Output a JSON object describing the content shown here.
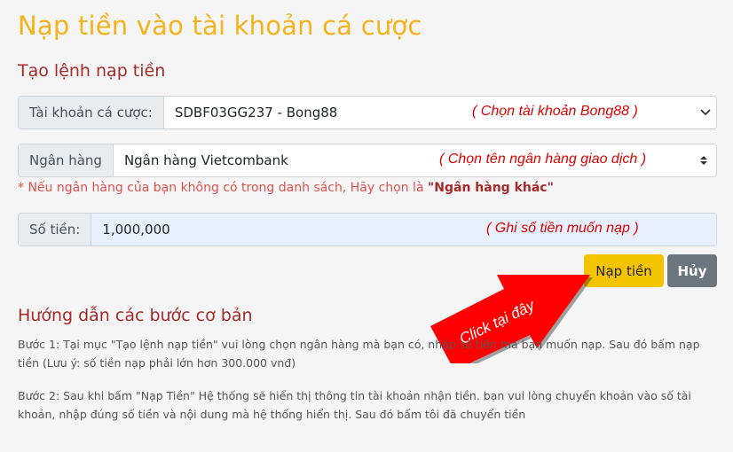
{
  "page_title": "Nạp tiền vào tài khoản cá cược",
  "form_title": "Tạo lệnh nạp tiền",
  "account": {
    "label": "Tài khoản cá cược:",
    "value": "SDBF03GG237 - Bong88",
    "hint": "( Chọn tài khoản Bong88 )"
  },
  "bank": {
    "label": "Ngân hàng",
    "value": "Ngân hàng Vietcombank",
    "hint": "( Chọn tên ngân hàng giao dịch )"
  },
  "bank_note": {
    "text": "* Nếu ngân hàng của bạn không có trong danh sách, Hãy chọn là ",
    "bold": "\"Ngân hàng khác\""
  },
  "amount": {
    "label": "Số tiền:",
    "value": "1,000,000",
    "hint": "( Ghi số tiền muốn nạp )"
  },
  "buttons": {
    "submit": "Nạp tiền",
    "cancel": "Hủy"
  },
  "annotation": "Click tại đây",
  "guide": {
    "title": "Hướng dẫn các bước cơ bản",
    "steps": [
      "Bước 1: Tại mục \"Tạo lệnh nạp tiền\" vui lòng chọn ngân hàng mà bạn có, nhập số tiền mà bạn muốn nạp. Sau đó bấm nạp tiền (Lưu ý: số tiền nạp phải lớn hơn 300.000 vnđ)",
      "Bước 2: Sau khi bấm \"Nạp Tiền\" Hệ thống sẽ hiển thị thông tin tài khoản nhận tiền. bạn vui lòng chuyển khoản vào số tài khoản, nhập đúng số tiền và nội dung mà hệ thống hiển thị. Sau đó bấm tôi đã chuyển tiền"
    ]
  }
}
